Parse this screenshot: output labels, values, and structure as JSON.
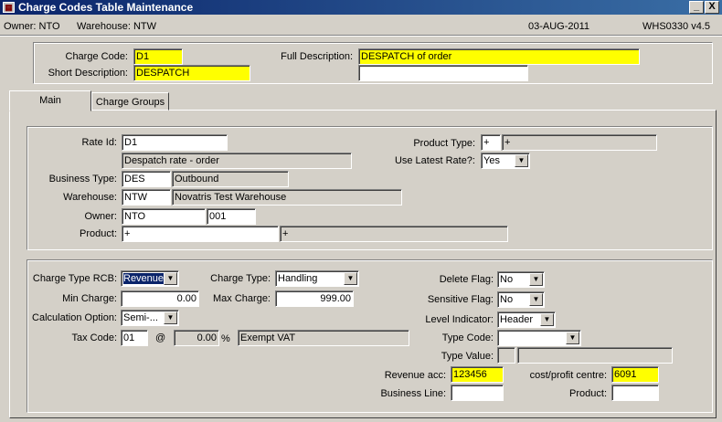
{
  "window": {
    "title": "Charge Codes Table Maintenance",
    "min_label": "_",
    "close_label": "X",
    "app_icon": "form-icon"
  },
  "info": {
    "owner": "Owner: NTO",
    "warehouse": "Warehouse: NTW",
    "date": "03-AUG-2011",
    "version": "WHS0330  v4.5"
  },
  "header": {
    "charge_code_label": "Charge Code:",
    "charge_code": "D1",
    "short_desc_label": "Short Description:",
    "short_desc": "DESPATCH",
    "full_desc_label": "Full Description:",
    "full_desc": "DESPATCH of order",
    "full_desc_2": ""
  },
  "tabs": [
    {
      "label": "Main"
    },
    {
      "label": "Charge Groups"
    }
  ],
  "rate": {
    "rate_id_label": "Rate Id:",
    "rate_id": "D1",
    "rate_desc": "Despatch rate - order",
    "business_type_label": "Business Type:",
    "business_type": "DES",
    "business_type_desc": "Outbound",
    "warehouse_label": "Warehouse:",
    "warehouse": "NTW",
    "warehouse_desc": "Novatris Test Warehouse",
    "owner_label": "Owner:",
    "owner": "NTO",
    "owner_2": "001",
    "product_label": "Product:",
    "product": "+",
    "product_desc": "+",
    "product_type_label": "Product Type:",
    "product_type": "+",
    "product_type_desc": "+",
    "use_latest_label": "Use Latest Rate?:",
    "use_latest": "Yes"
  },
  "charge": {
    "type_rcb_label": "Charge Type RCB:",
    "type_rcb": "Revenue",
    "charge_type_label": "Charge Type:",
    "charge_type": "Handling",
    "delete_flag_label": "Delete Flag:",
    "delete_flag": "No",
    "min_charge_label": "Min Charge:",
    "min_charge": "0.00",
    "max_charge_label": "Max Charge:",
    "max_charge": "999.00",
    "sensitive_flag_label": "Sensitive Flag:",
    "sensitive_flag": "No",
    "calc_option_label": "Calculation Option:",
    "calc_option": "Semi-...",
    "level_indicator_label": "Level Indicator:",
    "level_indicator": "Header",
    "tax_code_label": "Tax Code:",
    "tax_code": "01",
    "at": "@",
    "tax_rate": "0.00",
    "percent": "%",
    "tax_desc": "Exempt VAT",
    "type_code_label": "Type Code:",
    "type_code": "",
    "type_value_label": "Type Value:",
    "revenue_acc_label": "Revenue acc:",
    "revenue_acc": "123456",
    "cost_centre_label": "cost/profit centre:",
    "cost_centre": "6091",
    "business_line_label": "Business Line:",
    "business_line": "",
    "product_label": "Product:",
    "product": ""
  },
  "icons": {
    "dropdown": "chevron-down-icon"
  }
}
